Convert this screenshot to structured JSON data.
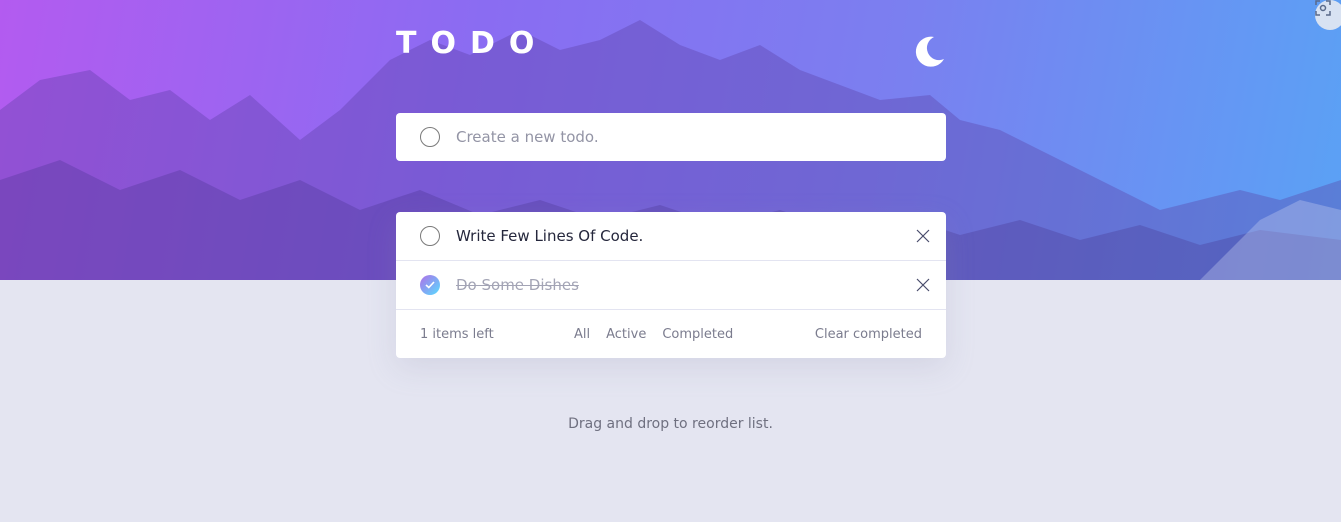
{
  "app": {
    "title": "TODO",
    "theme_icon": "moon-icon",
    "corner_icon": "screenshot-icon"
  },
  "new_todo": {
    "placeholder": "Create a new todo."
  },
  "todos": [
    {
      "text": "Write Few Lines Of Code.",
      "completed": false
    },
    {
      "text": "Do Some Dishes",
      "completed": true
    }
  ],
  "footer": {
    "items_left": "1 items left",
    "filters": [
      "All",
      "Active",
      "Completed"
    ],
    "clear_completed": "Clear completed"
  },
  "hint": "Drag and drop to reorder list.",
  "colors": {
    "gradient_start": "#b35bf0",
    "gradient_end": "#5aa2f5",
    "page_bg": "#e4e5f1",
    "check_gradient": [
      "#b06fe8",
      "#57ddff"
    ]
  }
}
